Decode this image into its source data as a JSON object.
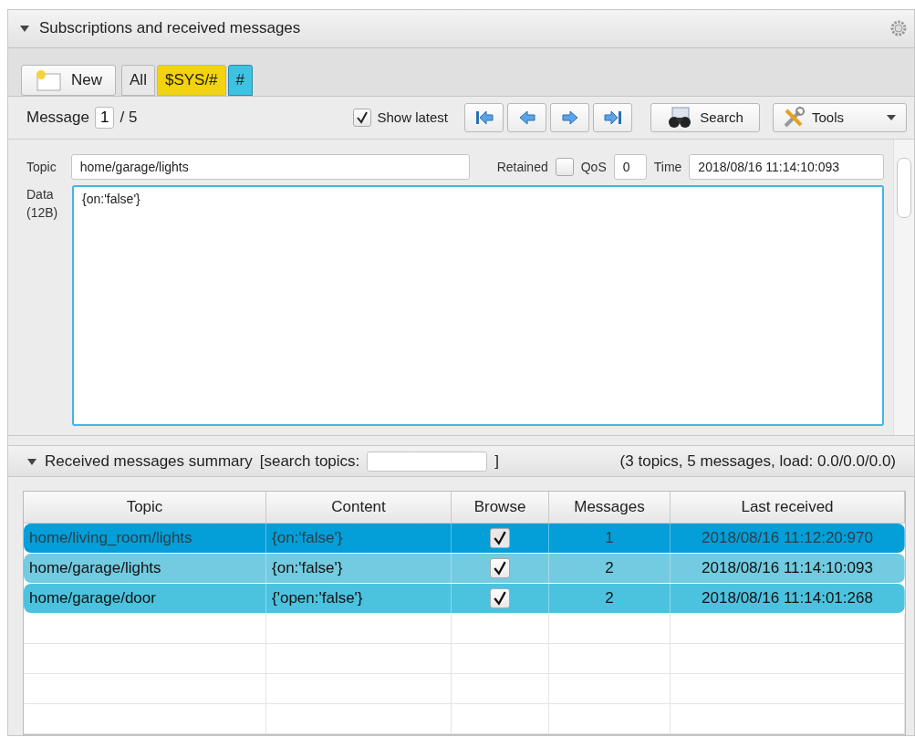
{
  "panel": {
    "title": "Subscriptions and received messages",
    "expanded": true
  },
  "new_button": "New",
  "tabs": [
    {
      "label": "All",
      "selected": false,
      "color": "#e8e8e8"
    },
    {
      "label": "$SYS/#",
      "selected": false,
      "color": "#f3d20f"
    },
    {
      "label": "#",
      "selected": true,
      "color": "#3fc2e2"
    }
  ],
  "message_nav": {
    "label": "Message",
    "index": "1",
    "total": "/ 5",
    "show_latest_label": "Show latest",
    "show_latest_checked": true,
    "search_button": "Search",
    "tools_button": "Tools"
  },
  "message": {
    "topic_label": "Topic",
    "topic": "home/garage/lights",
    "retained_label": "Retained",
    "retained": false,
    "qos_label": "QoS",
    "qos": "0",
    "time_label": "Time",
    "time": "2018/08/16 11:14:10:093",
    "data_label": "Data",
    "data_size": "(12B)",
    "data": "{on:'false'}"
  },
  "summary": {
    "title": "Received messages summary",
    "search_label": "[search topics:",
    "search_close": "]",
    "stats": "(3 topics, 5 messages, load: 0.0/0.0/0.0)",
    "expanded": true
  },
  "table": {
    "columns": [
      "Topic",
      "Content",
      "Browse",
      "Messages",
      "Last received"
    ],
    "rows": [
      {
        "topic": "home/living_room/lights",
        "content": "{on:'false'}",
        "browse": true,
        "messages": "1",
        "last_received": "2018/08/16 11:12:20:970",
        "color": "#049fd8",
        "selected": true
      },
      {
        "topic": "home/garage/lights",
        "content": "{on:'false'}",
        "browse": true,
        "messages": "2",
        "last_received": "2018/08/16 11:14:10:093",
        "color": "#72cbe0",
        "selected": false
      },
      {
        "topic": "home/garage/door",
        "content": "{'open:'false'}",
        "browse": true,
        "messages": "2",
        "last_received": "2018/08/16 11:14:01:268",
        "color": "#4bc3df",
        "selected": false
      }
    ]
  }
}
